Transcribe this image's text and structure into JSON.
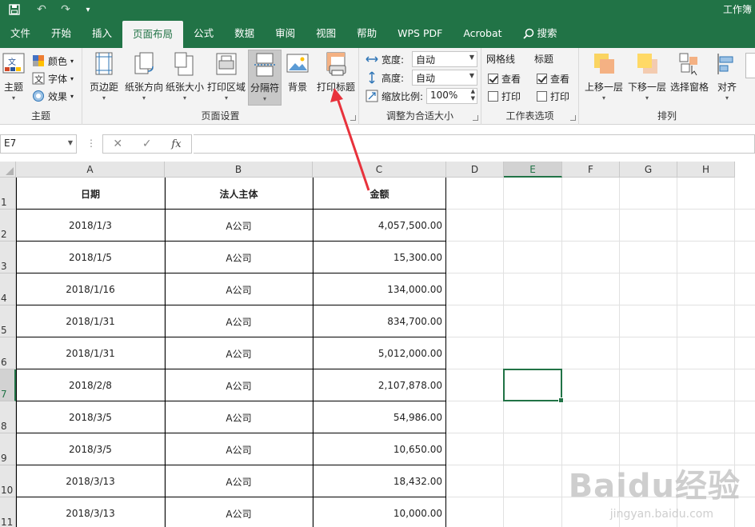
{
  "titlebar": {
    "title": "工作簿"
  },
  "tabs": [
    {
      "label": "文件"
    },
    {
      "label": "开始"
    },
    {
      "label": "插入"
    },
    {
      "label": "页面布局",
      "active": true
    },
    {
      "label": "公式"
    },
    {
      "label": "数据"
    },
    {
      "label": "审阅"
    },
    {
      "label": "视图"
    },
    {
      "label": "帮助"
    },
    {
      "label": "WPS PDF"
    },
    {
      "label": "Acrobat"
    },
    {
      "label": "搜索"
    }
  ],
  "ribbon": {
    "theme": {
      "group": "主题",
      "themes": "主题",
      "colors": "颜色",
      "fonts": "字体",
      "effects": "效果"
    },
    "page_setup": {
      "group": "页面设置",
      "margins": "页边距",
      "orientation": "纸张方向",
      "size": "纸张大小",
      "print_area": "打印区域",
      "breaks": "分隔符",
      "background": "背景",
      "print_titles": "打印标题"
    },
    "scale": {
      "group": "调整为合适大小",
      "width_label": "宽度:",
      "width_value": "自动",
      "height_label": "高度:",
      "height_value": "自动",
      "scale_label": "缩放比例:",
      "scale_value": "100%"
    },
    "sheet_options": {
      "group": "工作表选项",
      "gridlines": "网格线",
      "headings": "标题",
      "view": "查看",
      "print": "打印"
    },
    "arrange": {
      "group": "排列",
      "bring_forward": "上移一层",
      "send_backward": "下移一层",
      "selection_pane": "选择窗格",
      "align": "对齐"
    }
  },
  "formula_bar": {
    "name_box": "E7",
    "fx": "fx",
    "cancel": "✕",
    "enter": "✓",
    "value": ""
  },
  "columns": [
    "A",
    "B",
    "C",
    "D",
    "E",
    "F",
    "G",
    "H"
  ],
  "selected_column": "E",
  "selected_row": "7",
  "table": {
    "headers": [
      "日期",
      "法人主体",
      "金额"
    ],
    "rows": [
      {
        "date": "2018/1/3",
        "entity": "A公司",
        "amount": "4,057,500.00"
      },
      {
        "date": "2018/1/5",
        "entity": "A公司",
        "amount": "15,300.00"
      },
      {
        "date": "2018/1/16",
        "entity": "A公司",
        "amount": "134,000.00"
      },
      {
        "date": "2018/1/31",
        "entity": "A公司",
        "amount": "834,700.00"
      },
      {
        "date": "2018/1/31",
        "entity": "A公司",
        "amount": "5,012,000.00"
      },
      {
        "date": "2018/2/8",
        "entity": "A公司",
        "amount": "2,107,878.00"
      },
      {
        "date": "2018/3/5",
        "entity": "A公司",
        "amount": "54,986.00"
      },
      {
        "date": "2018/3/5",
        "entity": "A公司",
        "amount": "10,650.00"
      },
      {
        "date": "2018/3/13",
        "entity": "A公司",
        "amount": "18,432.00"
      },
      {
        "date": "2018/3/13",
        "entity": "A公司",
        "amount": "10,000.00"
      }
    ]
  },
  "row_numbers": [
    "1",
    "2",
    "3",
    "4",
    "5",
    "6",
    "7",
    "8",
    "9",
    "10",
    "11"
  ],
  "watermark": {
    "brand": "Baidu经验",
    "url": "jingyan.baidu.com"
  },
  "colors": {
    "accent": "#217346",
    "annotation_arrow": "#e8323c"
  }
}
